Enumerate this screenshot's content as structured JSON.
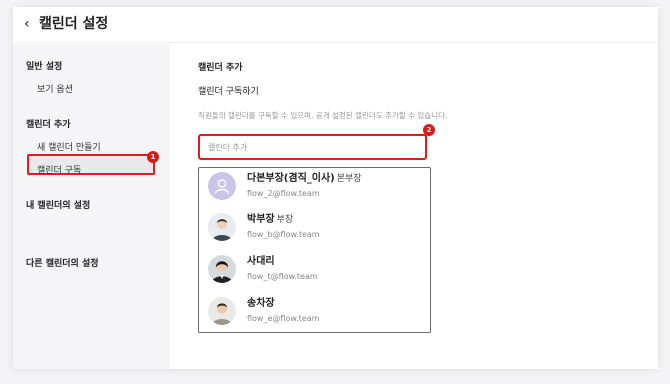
{
  "header": {
    "back_icon": "chevron-left-icon",
    "title": "캘린더 설정"
  },
  "sidebar": {
    "general": "일반 설정",
    "view_options": "보기 옵션",
    "add_calendar": "캘린더 추가",
    "new_calendar": "새 캘린더 만들기",
    "subscribe": "캘린더 구독",
    "my_calendar_settings": "내 캘린더의 설정",
    "other_calendar_settings": "다른 캘린더의 설정"
  },
  "main": {
    "section_title": "캘린더 추가",
    "subtitle": "캘린더 구독하기",
    "description": "직원들의 캘린더를 구독할 수 있으며, 공개 설정된 캘린더도 추가할 수 있습니다.",
    "search_placeholder": "캘린더 추가"
  },
  "badges": {
    "one": "1",
    "two": "2"
  },
  "results": [
    {
      "name": "다본부장(겸직_이사)",
      "position": "본부장",
      "email": "flow_2@flow.team",
      "avatar": "default-user-icon"
    },
    {
      "name": "박부장",
      "position": "부장",
      "email": "flow_b@flow.team",
      "avatar": "user-photo"
    },
    {
      "name": "사대리",
      "position": "",
      "email": "flow_t@flow.team",
      "avatar": "user-photo"
    },
    {
      "name": "송차장",
      "position": "",
      "email": "flow_e@flow.team",
      "avatar": "user-photo"
    }
  ],
  "colors": {
    "highlight": "#e21d1d",
    "badge": "#d81b1b",
    "default_avatar": "#c9c5e8"
  }
}
